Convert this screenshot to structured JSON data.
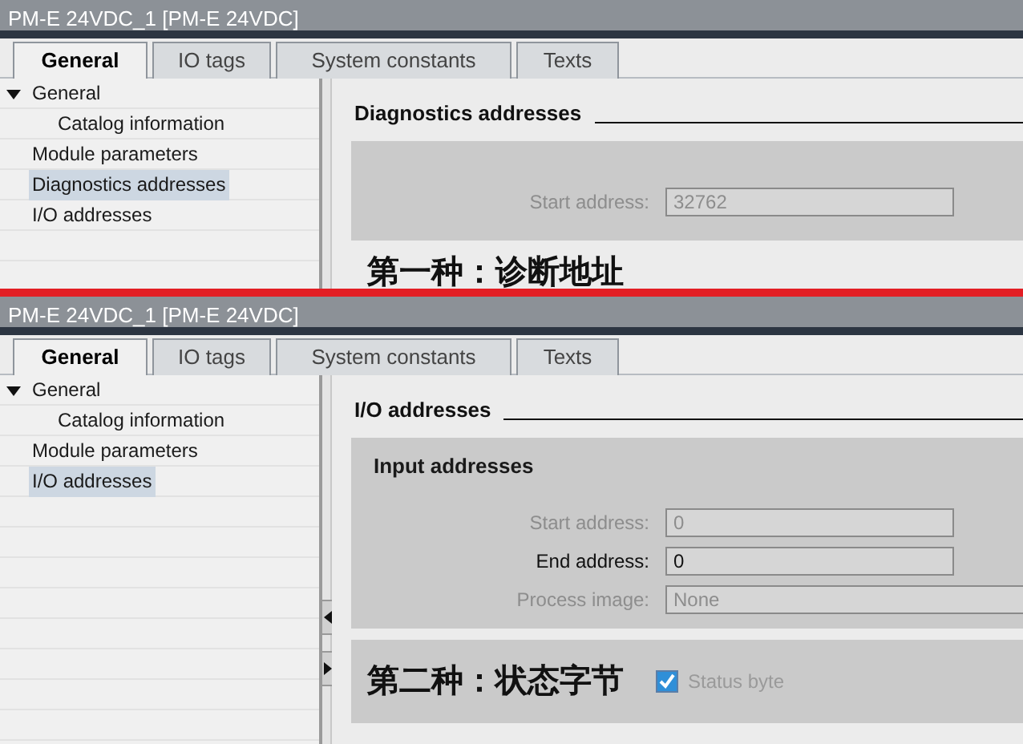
{
  "panels": [
    {
      "title": "PM-E 24VDC_1 [PM-E 24VDC]",
      "tabs": [
        {
          "label": "General",
          "selected": true
        },
        {
          "label": "IO tags",
          "selected": false
        },
        {
          "label": "System constants",
          "selected": false
        },
        {
          "label": "Texts",
          "selected": false
        }
      ],
      "nav": [
        {
          "label": "General",
          "expanded": true,
          "selected": false,
          "children": [
            {
              "label": "Catalog information",
              "selected": false
            }
          ]
        },
        {
          "label": "Module parameters",
          "selected": false
        },
        {
          "label": "Diagnostics addresses",
          "selected": true
        },
        {
          "label": "I/O addresses",
          "selected": false
        }
      ],
      "section": {
        "heading": "Diagnostics addresses",
        "blocks": [
          {
            "kind": "group",
            "rows": [
              {
                "kind": "field",
                "label": "Start address:",
                "value": "32762",
                "disabled": true
              }
            ]
          },
          {
            "kind": "note",
            "text": "第一种：诊断地址"
          }
        ]
      }
    },
    {
      "title": "PM-E 24VDC_1 [PM-E 24VDC]",
      "tabs": [
        {
          "label": "General",
          "selected": true
        },
        {
          "label": "IO tags",
          "selected": false
        },
        {
          "label": "System constants",
          "selected": false
        },
        {
          "label": "Texts",
          "selected": false
        }
      ],
      "nav": [
        {
          "label": "General",
          "expanded": true,
          "selected": false,
          "children": [
            {
              "label": "Catalog information",
              "selected": false
            }
          ]
        },
        {
          "label": "Module parameters",
          "selected": false
        },
        {
          "label": "I/O addresses",
          "selected": true
        }
      ],
      "section": {
        "heading": "I/O addresses",
        "blocks": [
          {
            "kind": "group",
            "heading": "Input addresses",
            "rows": [
              {
                "kind": "field",
                "label": "Start address:",
                "value": "0",
                "disabled": true
              },
              {
                "kind": "field",
                "label": "End address:",
                "value": "0",
                "disabled": false
              },
              {
                "kind": "dropdown",
                "label": "Process image:",
                "value": "None",
                "disabled": true
              }
            ]
          },
          {
            "kind": "group",
            "rows": [
              {
                "kind": "note",
                "text": "第二种：状态字节",
                "checkbox": {
                  "label": "Status byte",
                  "checked": true
                }
              }
            ]
          }
        ]
      }
    }
  ]
}
